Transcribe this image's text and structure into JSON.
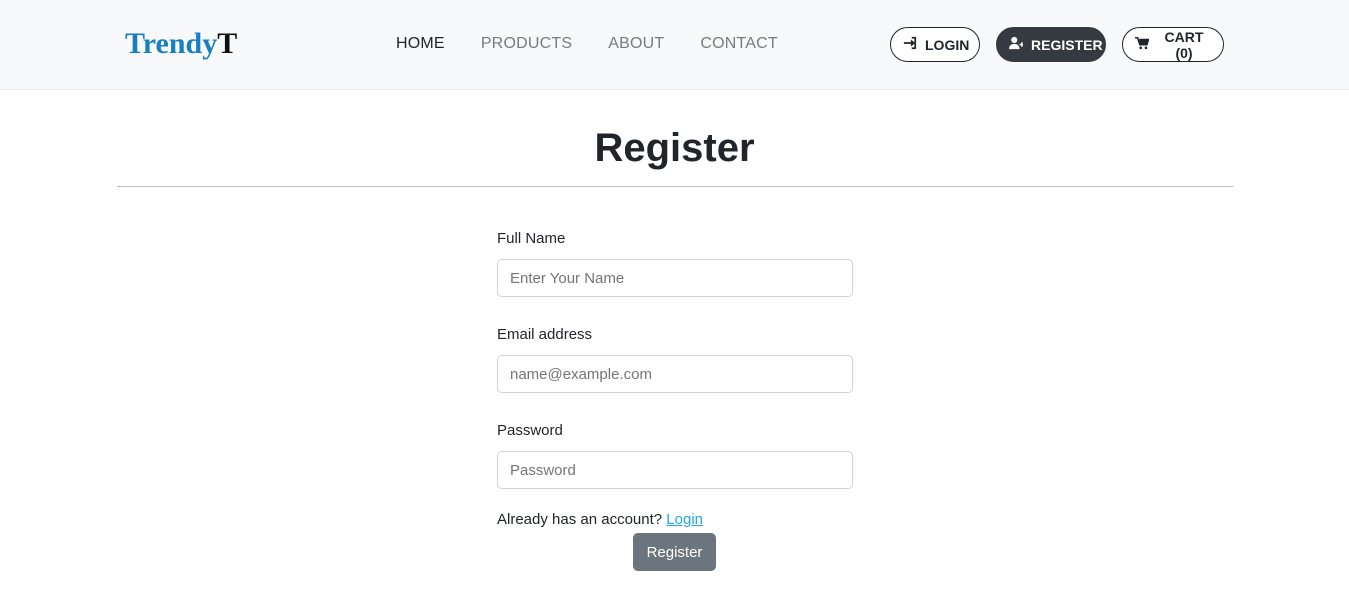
{
  "brand": {
    "part1": "Trendy",
    "part2": "T"
  },
  "nav": {
    "links": [
      "HOME",
      "PRODUCTS",
      "ABOUT",
      "CONTACT"
    ],
    "active": "HOME",
    "login_label": "LOGIN",
    "register_label": "REGISTER",
    "cart_label": "CART (0)"
  },
  "page": {
    "title": "Register"
  },
  "form": {
    "name_label": "Full Name",
    "name_placeholder": "Enter Your Name",
    "email_label": "Email address",
    "email_placeholder": "name@example.com",
    "password_label": "Password",
    "password_placeholder": "Password",
    "account_text": "Already has an account?",
    "login_link": "Login",
    "submit_label": "Register"
  },
  "colors": {
    "brand_blue": "#1a7fc1",
    "dark": "#343a40",
    "link": "#1ea7e0",
    "submit": "#6c757d"
  },
  "icons": {
    "login": "sign-in-icon",
    "register": "user-plus-icon",
    "cart": "cart-icon"
  }
}
